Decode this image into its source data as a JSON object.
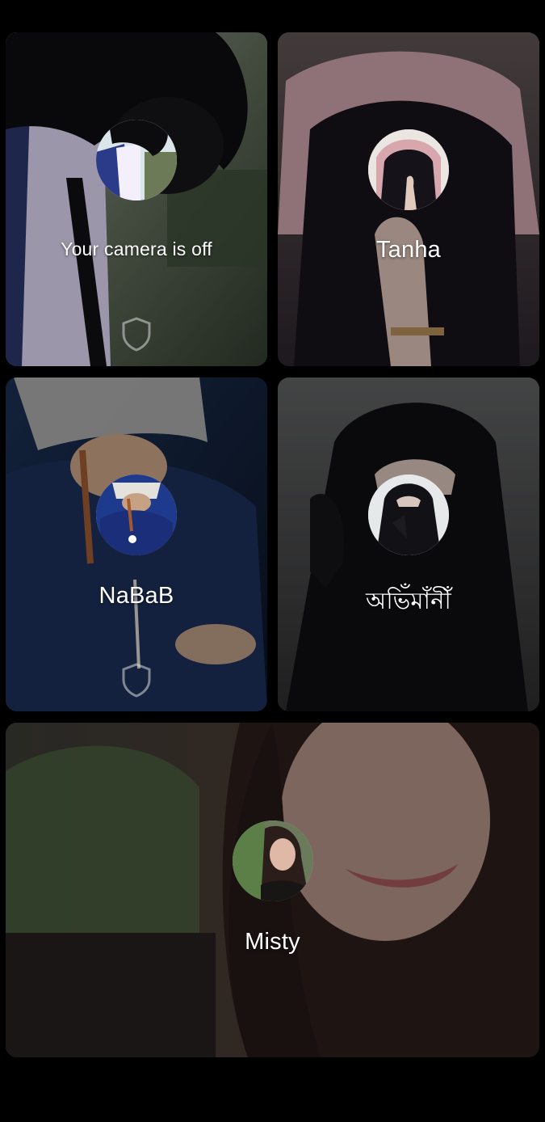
{
  "participants": [
    {
      "id": "self",
      "name": "Your camera is off",
      "avatar_icon": "user-avatar-photo",
      "has_shield_badge": true,
      "colors": {
        "bg_a": "#a39db8",
        "bg_b": "#3f4a3c",
        "hair": "#0f0f12",
        "shirt": "#dcd6ef",
        "jacket": "#2a3566"
      }
    },
    {
      "id": "tanha",
      "name": "Tanha",
      "avatar_icon": "user-avatar-photo",
      "has_shield_badge": false,
      "colors": {
        "bg_a": "#5b4f50",
        "bg_b": "#241f25",
        "scarf": "#caa2a8",
        "veil": "#17131b",
        "hand": "#d9c1b4"
      }
    },
    {
      "id": "nabab",
      "name": "NaBaB",
      "avatar_icon": "user-avatar-photo",
      "has_shield_badge": true,
      "colors": {
        "bg_a": "#162a4a",
        "bg_b": "#0c1424",
        "scarf": "#c8c5c0",
        "jacket": "#1c3159",
        "beads": "#9c5a32",
        "skin": "#c9a386"
      }
    },
    {
      "id": "abhimani",
      "name": "অভিঁমাঁনীঁ",
      "avatar_icon": "user-avatar-photo",
      "has_shield_badge": false,
      "colors": {
        "bg_a": "#5c5d5e",
        "bg_b": "#2a2a2b",
        "veil": "#0d0d10",
        "skin": "#d3c0b6"
      }
    },
    {
      "id": "misty",
      "name": "Misty",
      "avatar_icon": "user-avatar-photo",
      "has_shield_badge": false,
      "colors": {
        "bg_a": "#6c5a52",
        "bg_b": "#241d1c",
        "hair": "#2b1f1c",
        "skin": "#c8a597",
        "plant": "#4d6a42",
        "lips": "#b15a5f"
      }
    }
  ]
}
